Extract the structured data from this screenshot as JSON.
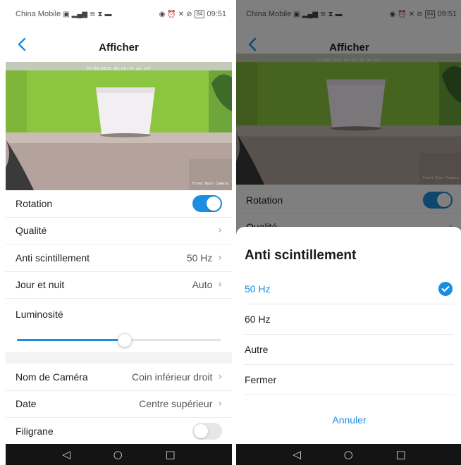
{
  "status_bar": {
    "carrier": "China Mobile",
    "time": "09:51",
    "battery": "84"
  },
  "header": {
    "title": "Afficher"
  },
  "preview": {
    "timestamp": "07/08/2022 09:50:14 am CST",
    "camera_name": "Front Door Camera"
  },
  "settings": {
    "rotation": {
      "label": "Rotation",
      "enabled": true
    },
    "quality": {
      "label": "Qualité"
    },
    "anti_flicker": {
      "label": "Anti scintillement",
      "value": "50 Hz"
    },
    "day_night": {
      "label": "Jour et nuit",
      "value": "Auto"
    },
    "brightness": {
      "label": "Luminosité",
      "level": 0.53
    },
    "camera_name": {
      "label": "Nom de Caméra",
      "value": "Coin inférieur droit"
    },
    "date": {
      "label": "Date",
      "value": "Centre supérieur"
    },
    "watermark": {
      "label": "Filigrane",
      "enabled": false
    }
  },
  "sheet": {
    "title": "Anti scintillement",
    "options": [
      {
        "label": "50 Hz",
        "selected": true
      },
      {
        "label": "60 Hz",
        "selected": false
      },
      {
        "label": "Autre",
        "selected": false
      },
      {
        "label": "Fermer",
        "selected": false
      }
    ],
    "cancel_label": "Annuler"
  },
  "colors": {
    "accent": "#1a8ee0",
    "wall_green": "#8cc63e",
    "floor": "#b3a39c"
  },
  "icons": {
    "back": "chevron-left-icon",
    "chevron": "chevron-right-icon",
    "check": "check-circle-icon",
    "nav_back": "triangle-back-icon",
    "nav_home": "circle-home-icon",
    "nav_recent": "square-recent-icon"
  }
}
